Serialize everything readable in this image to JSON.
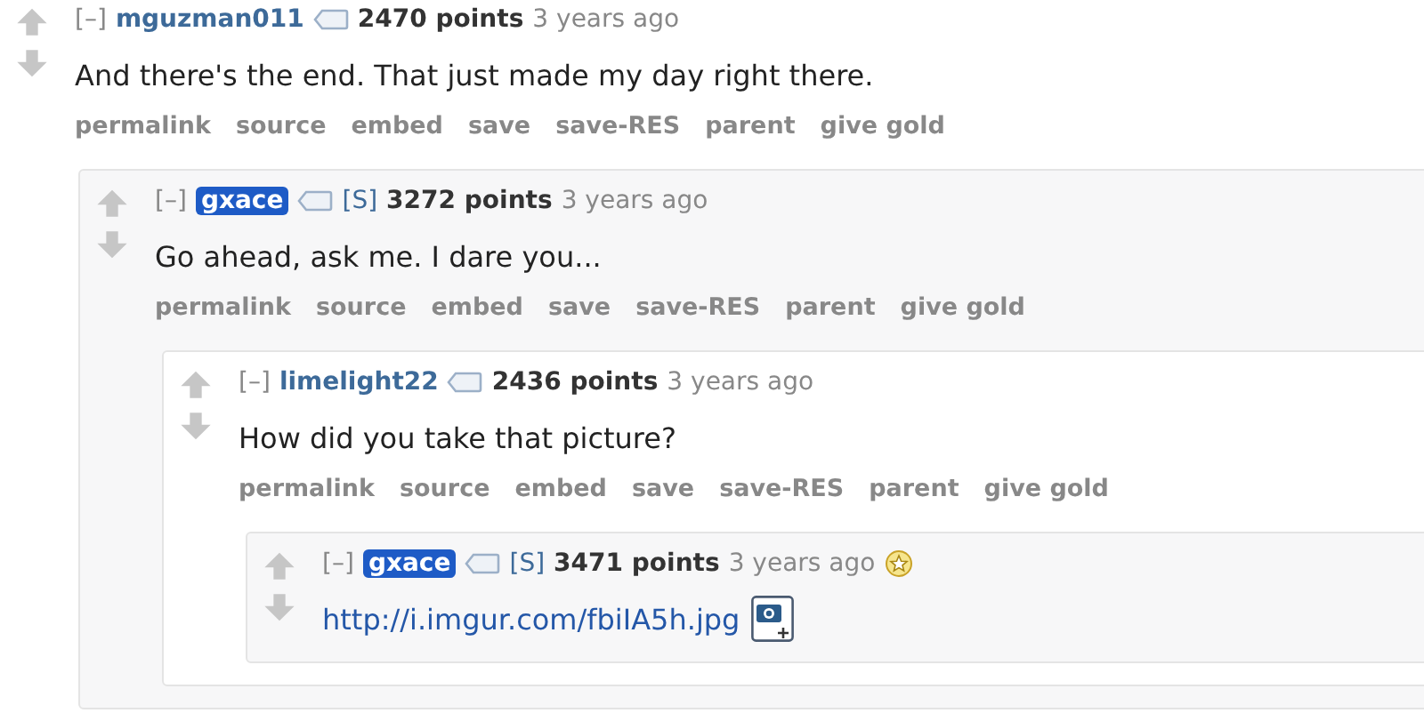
{
  "comments": [
    {
      "collapse": "[–]",
      "author": "mguzman011",
      "submitter": false,
      "points": "2470 points",
      "time": "3 years ago",
      "gilded": false,
      "body": {
        "kind": "text",
        "text": "And there's the end. That just made my day right there."
      },
      "actions": [
        "permalink",
        "source",
        "embed",
        "save",
        "save-RES",
        "parent",
        "give gold"
      ],
      "children": [
        {
          "collapse": "[–]",
          "author": "gxace",
          "submitter": true,
          "submitter_mark": "[S]",
          "points": "3272 points",
          "time": "3 years ago",
          "gilded": false,
          "body": {
            "kind": "text",
            "text": "Go ahead, ask me. I dare you..."
          },
          "actions": [
            "permalink",
            "source",
            "embed",
            "save",
            "save-RES",
            "parent",
            "give gold"
          ],
          "children": [
            {
              "collapse": "[–]",
              "author": "limelight22",
              "submitter": false,
              "points": "2436 points",
              "time": "3 years ago",
              "gilded": false,
              "body": {
                "kind": "text",
                "text": "How did you take that picture?"
              },
              "actions": [
                "permalink",
                "source",
                "embed",
                "save",
                "save-RES",
                "parent",
                "give gold"
              ],
              "children": [
                {
                  "collapse": "[–]",
                  "author": "gxace",
                  "submitter": true,
                  "submitter_mark": "[S]",
                  "points": "3471 points",
                  "time": "3 years ago",
                  "gilded": true,
                  "body": {
                    "kind": "link",
                    "text": "http://i.imgur.com/fbiIA5h.jpg"
                  }
                }
              ]
            }
          ]
        }
      ]
    }
  ]
}
